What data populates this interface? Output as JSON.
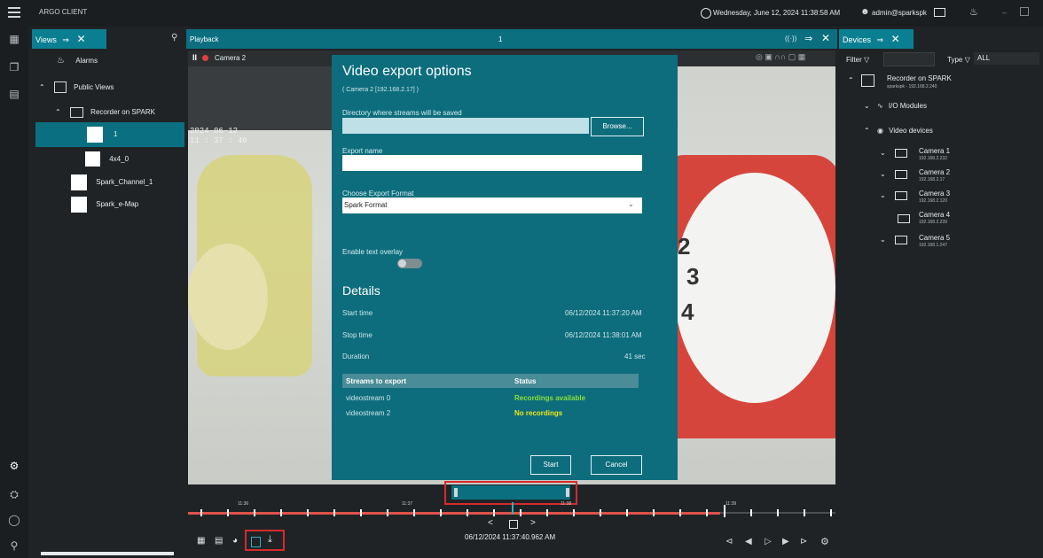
{
  "app": {
    "title": "ARGO CLIENT",
    "datetime": "Wednesday, June 12, 2024 11:38:58 AM",
    "user": "admin@sparkspk"
  },
  "views_panel": {
    "tab_label": "Views",
    "items": [
      {
        "label": "Alarms"
      },
      {
        "label": "Public Views"
      },
      {
        "label": "Recorder on SPARK"
      },
      {
        "label": "1"
      },
      {
        "label": "4x4_0"
      },
      {
        "label": "Spark_Channel_1"
      },
      {
        "label": "Spark_e-Map"
      }
    ]
  },
  "playback": {
    "tab_label": "Playback",
    "tab_number": "1",
    "camera_label": "Camera 2",
    "overlay_date": "2024-06-12",
    "overlay_time": "11 : 37 : 40",
    "timeline_labels": [
      "11:36",
      "11:37",
      "11:38",
      "11:39"
    ],
    "current_time": "06/12/2024 11:37:40.962 AM"
  },
  "dialog": {
    "title": "Video export options",
    "subtitle": "( Camera 2 [192.168.2.17] )",
    "dir_label": "Directory where streams will be saved",
    "dir_value": "",
    "browse_label": "Browse...",
    "export_name_label": "Export name",
    "export_name_value": "",
    "format_label": "Choose Export Format",
    "format_value": "Spark Format",
    "overlay_label": "Enable text overlay",
    "details_heading": "Details",
    "start_time_label": "Start time",
    "start_time_value": "06/12/2024 11:37:20 AM",
    "stop_time_label": "Stop time",
    "stop_time_value": "06/12/2024 11:38:01 AM",
    "duration_label": "Duration",
    "duration_value": "41 sec",
    "streams_header": "Streams to export",
    "status_header": "Status",
    "streams": [
      {
        "name": "videostream 0",
        "status": "Recordings available",
        "status_color": "#8dde3b"
      },
      {
        "name": "videostream 2",
        "status": "No recordings",
        "status_color": "#f0e61c"
      }
    ],
    "start_button": "Start",
    "cancel_button": "Cancel"
  },
  "devices_panel": {
    "tab_label": "Devices",
    "filter_label": "Filter",
    "type_label": "Type",
    "type_value": "ALL",
    "recorder": {
      "label": "Recorder on SPARK",
      "sub": "sparkspk - 192.168.2.240"
    },
    "io_modules": "I/O Modules",
    "video_devices": "Video devices",
    "cameras": [
      {
        "name": "Camera 1",
        "ip": "192.168.2.232"
      },
      {
        "name": "Camera 2",
        "ip": "192.168.2.17"
      },
      {
        "name": "Camera 3",
        "ip": "192.168.2.120"
      },
      {
        "name": "Camera 4",
        "ip": "192.168.2.239"
      },
      {
        "name": "Camera 5",
        "ip": "192.168.1.247"
      }
    ]
  },
  "colors": {
    "accent": "#0b7f92",
    "dialog_bg": "#0d6d7c",
    "timeline_red": "#e0534a",
    "highlight_red": "#d42b2b"
  }
}
